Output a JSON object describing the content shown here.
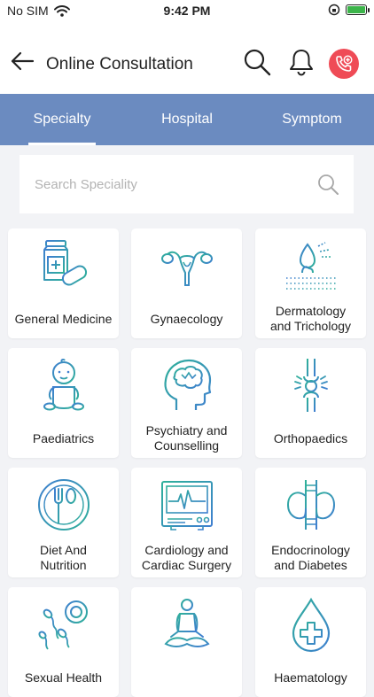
{
  "status_bar": {
    "carrier": "No SIM",
    "time": "9:42 PM",
    "battery_level": 1.0
  },
  "header": {
    "title": "Online Consultation"
  },
  "tabs": [
    {
      "label": "Specialty",
      "active": true
    },
    {
      "label": "Hospital",
      "active": false
    },
    {
      "label": "Symptom",
      "active": false
    }
  ],
  "search": {
    "placeholder": "Search Speciality",
    "value": ""
  },
  "specialties": [
    {
      "label": "General Medicine",
      "icon": "medicine-bottle-icon"
    },
    {
      "label": "Gynaecology",
      "icon": "uterus-icon"
    },
    {
      "label": "Dermatology\nand Trichology",
      "icon": "skin-hair-icon"
    },
    {
      "label": "Paediatrics",
      "icon": "baby-icon"
    },
    {
      "label": "Psychiatry and\nCounselling",
      "icon": "brain-head-icon"
    },
    {
      "label": "Orthopaedics",
      "icon": "knee-bone-icon"
    },
    {
      "label": "Diet And\nNutrition",
      "icon": "plate-fork-spoon-icon"
    },
    {
      "label": "Cardiology and\nCardiac Surgery",
      "icon": "ecg-monitor-icon"
    },
    {
      "label": "Endocrinology\nand Diabetes",
      "icon": "thyroid-icon"
    },
    {
      "label": "Sexual Health",
      "icon": "sperm-egg-icon"
    },
    {
      "label": "",
      "icon": "meditation-icon"
    },
    {
      "label": "Haematology",
      "icon": "blood-drop-icon"
    }
  ],
  "colors": {
    "tab_bar": "#6b8bc0",
    "call_button": "#ef4b56",
    "icon_teal": "#2fa89a",
    "icon_blue": "#3f7fd0"
  }
}
